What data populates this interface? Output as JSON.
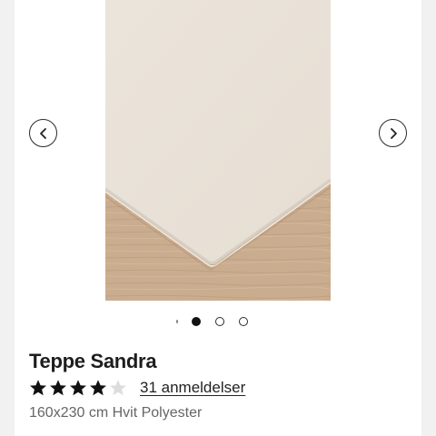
{
  "product": {
    "title": "Teppe Sandra",
    "rating": 4,
    "rating_max": 5,
    "reviews_label": "31 anmeldelser",
    "details": "160x230 cm Hvit Polyester"
  },
  "gallery": {
    "slide_count": 3,
    "active_slide": 1,
    "prev_icon": "chevron-left-icon",
    "next_icon": "chevron-right-icon"
  },
  "colors": {
    "star_filled": "#111111",
    "star_empty": "#dddddd",
    "rug": "#ece5dc",
    "floor": "#c9ab8e"
  }
}
